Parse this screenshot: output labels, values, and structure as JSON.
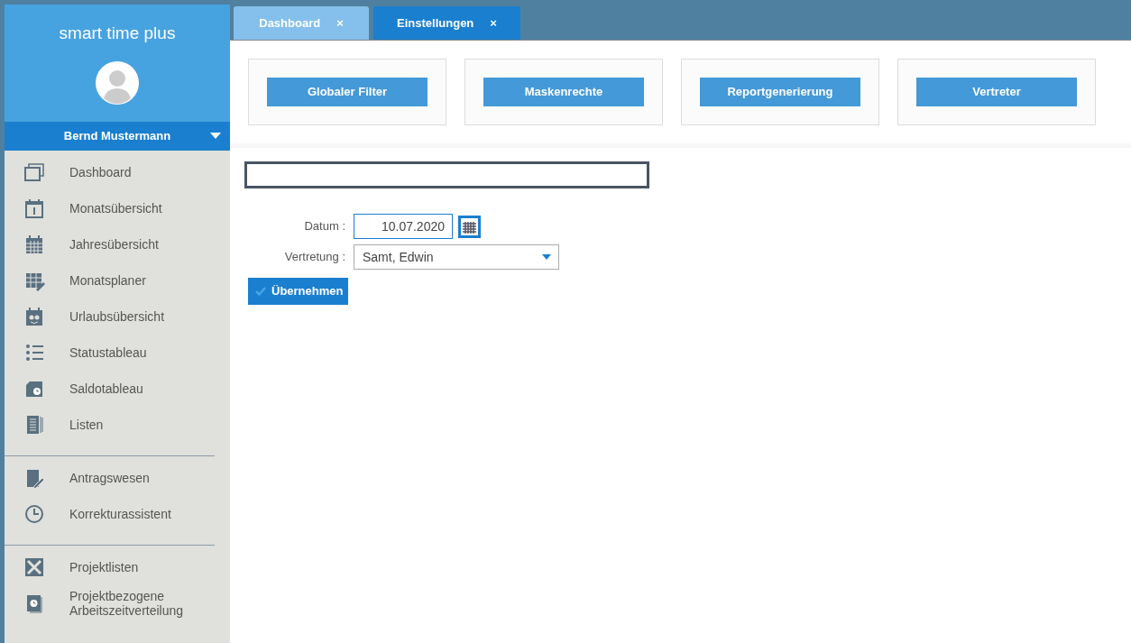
{
  "app": {
    "title": "smart time plus",
    "user": "Bernd Mustermann"
  },
  "sidebar": {
    "groups": [
      [
        {
          "label": "Dashboard"
        },
        {
          "label": "Monatsübersicht"
        },
        {
          "label": "Jahresübersicht"
        },
        {
          "label": "Monatsplaner"
        },
        {
          "label": "Urlaubsübersicht"
        },
        {
          "label": "Statustableau"
        },
        {
          "label": "Saldotableau"
        },
        {
          "label": "Listen"
        }
      ],
      [
        {
          "label": "Antragswesen"
        },
        {
          "label": "Korrekturassistent"
        }
      ],
      [
        {
          "label": "Projektlisten"
        },
        {
          "label": "Projektbezogene Arbeitszeitverteilung"
        }
      ]
    ]
  },
  "tabs": [
    {
      "label": "Dashboard",
      "close": "×",
      "selected": false
    },
    {
      "label": "Einstellungen",
      "close": "×",
      "selected": true
    }
  ],
  "tiles": [
    "Globaler Filter",
    "Maskenrechte",
    "Reportgenerierung",
    "Vertreter"
  ],
  "form": {
    "date_label": "Datum :",
    "date_value": "10.07.2020",
    "substitute_label": "Vertretung :",
    "substitute_value": "Samt, Edwin",
    "submit": "Übernehmen"
  }
}
